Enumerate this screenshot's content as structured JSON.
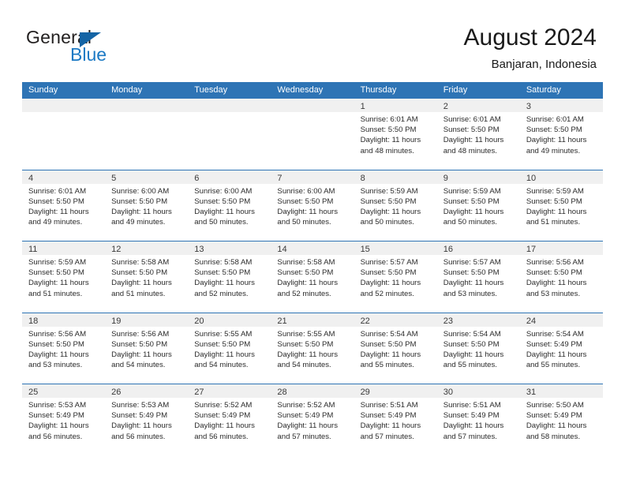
{
  "brand": {
    "name_primary": "General",
    "name_secondary": "Blue",
    "triangle_icon": "triangle-icon",
    "accent_color": "#1b79c4"
  },
  "header": {
    "title": "August 2024",
    "location": "Banjaran, Indonesia"
  },
  "calendar": {
    "header_bg": "#2e74b5",
    "daynum_bg": "#f0f0f0",
    "weekdays": [
      "Sunday",
      "Monday",
      "Tuesday",
      "Wednesday",
      "Thursday",
      "Friday",
      "Saturday"
    ],
    "weeks": [
      [
        {
          "day": "",
          "empty": true
        },
        {
          "day": "",
          "empty": true
        },
        {
          "day": "",
          "empty": true
        },
        {
          "day": "",
          "empty": true
        },
        {
          "day": "1",
          "sunrise": "Sunrise: 6:01 AM",
          "sunset": "Sunset: 5:50 PM",
          "daylight_1": "Daylight: 11 hours",
          "daylight_2": "and 48 minutes."
        },
        {
          "day": "2",
          "sunrise": "Sunrise: 6:01 AM",
          "sunset": "Sunset: 5:50 PM",
          "daylight_1": "Daylight: 11 hours",
          "daylight_2": "and 48 minutes."
        },
        {
          "day": "3",
          "sunrise": "Sunrise: 6:01 AM",
          "sunset": "Sunset: 5:50 PM",
          "daylight_1": "Daylight: 11 hours",
          "daylight_2": "and 49 minutes."
        }
      ],
      [
        {
          "day": "4",
          "sunrise": "Sunrise: 6:01 AM",
          "sunset": "Sunset: 5:50 PM",
          "daylight_1": "Daylight: 11 hours",
          "daylight_2": "and 49 minutes."
        },
        {
          "day": "5",
          "sunrise": "Sunrise: 6:00 AM",
          "sunset": "Sunset: 5:50 PM",
          "daylight_1": "Daylight: 11 hours",
          "daylight_2": "and 49 minutes."
        },
        {
          "day": "6",
          "sunrise": "Sunrise: 6:00 AM",
          "sunset": "Sunset: 5:50 PM",
          "daylight_1": "Daylight: 11 hours",
          "daylight_2": "and 50 minutes."
        },
        {
          "day": "7",
          "sunrise": "Sunrise: 6:00 AM",
          "sunset": "Sunset: 5:50 PM",
          "daylight_1": "Daylight: 11 hours",
          "daylight_2": "and 50 minutes."
        },
        {
          "day": "8",
          "sunrise": "Sunrise: 5:59 AM",
          "sunset": "Sunset: 5:50 PM",
          "daylight_1": "Daylight: 11 hours",
          "daylight_2": "and 50 minutes."
        },
        {
          "day": "9",
          "sunrise": "Sunrise: 5:59 AM",
          "sunset": "Sunset: 5:50 PM",
          "daylight_1": "Daylight: 11 hours",
          "daylight_2": "and 50 minutes."
        },
        {
          "day": "10",
          "sunrise": "Sunrise: 5:59 AM",
          "sunset": "Sunset: 5:50 PM",
          "daylight_1": "Daylight: 11 hours",
          "daylight_2": "and 51 minutes."
        }
      ],
      [
        {
          "day": "11",
          "sunrise": "Sunrise: 5:59 AM",
          "sunset": "Sunset: 5:50 PM",
          "daylight_1": "Daylight: 11 hours",
          "daylight_2": "and 51 minutes."
        },
        {
          "day": "12",
          "sunrise": "Sunrise: 5:58 AM",
          "sunset": "Sunset: 5:50 PM",
          "daylight_1": "Daylight: 11 hours",
          "daylight_2": "and 51 minutes."
        },
        {
          "day": "13",
          "sunrise": "Sunrise: 5:58 AM",
          "sunset": "Sunset: 5:50 PM",
          "daylight_1": "Daylight: 11 hours",
          "daylight_2": "and 52 minutes."
        },
        {
          "day": "14",
          "sunrise": "Sunrise: 5:58 AM",
          "sunset": "Sunset: 5:50 PM",
          "daylight_1": "Daylight: 11 hours",
          "daylight_2": "and 52 minutes."
        },
        {
          "day": "15",
          "sunrise": "Sunrise: 5:57 AM",
          "sunset": "Sunset: 5:50 PM",
          "daylight_1": "Daylight: 11 hours",
          "daylight_2": "and 52 minutes."
        },
        {
          "day": "16",
          "sunrise": "Sunrise: 5:57 AM",
          "sunset": "Sunset: 5:50 PM",
          "daylight_1": "Daylight: 11 hours",
          "daylight_2": "and 53 minutes."
        },
        {
          "day": "17",
          "sunrise": "Sunrise: 5:56 AM",
          "sunset": "Sunset: 5:50 PM",
          "daylight_1": "Daylight: 11 hours",
          "daylight_2": "and 53 minutes."
        }
      ],
      [
        {
          "day": "18",
          "sunrise": "Sunrise: 5:56 AM",
          "sunset": "Sunset: 5:50 PM",
          "daylight_1": "Daylight: 11 hours",
          "daylight_2": "and 53 minutes."
        },
        {
          "day": "19",
          "sunrise": "Sunrise: 5:56 AM",
          "sunset": "Sunset: 5:50 PM",
          "daylight_1": "Daylight: 11 hours",
          "daylight_2": "and 54 minutes."
        },
        {
          "day": "20",
          "sunrise": "Sunrise: 5:55 AM",
          "sunset": "Sunset: 5:50 PM",
          "daylight_1": "Daylight: 11 hours",
          "daylight_2": "and 54 minutes."
        },
        {
          "day": "21",
          "sunrise": "Sunrise: 5:55 AM",
          "sunset": "Sunset: 5:50 PM",
          "daylight_1": "Daylight: 11 hours",
          "daylight_2": "and 54 minutes."
        },
        {
          "day": "22",
          "sunrise": "Sunrise: 5:54 AM",
          "sunset": "Sunset: 5:50 PM",
          "daylight_1": "Daylight: 11 hours",
          "daylight_2": "and 55 minutes."
        },
        {
          "day": "23",
          "sunrise": "Sunrise: 5:54 AM",
          "sunset": "Sunset: 5:50 PM",
          "daylight_1": "Daylight: 11 hours",
          "daylight_2": "and 55 minutes."
        },
        {
          "day": "24",
          "sunrise": "Sunrise: 5:54 AM",
          "sunset": "Sunset: 5:49 PM",
          "daylight_1": "Daylight: 11 hours",
          "daylight_2": "and 55 minutes."
        }
      ],
      [
        {
          "day": "25",
          "sunrise": "Sunrise: 5:53 AM",
          "sunset": "Sunset: 5:49 PM",
          "daylight_1": "Daylight: 11 hours",
          "daylight_2": "and 56 minutes."
        },
        {
          "day": "26",
          "sunrise": "Sunrise: 5:53 AM",
          "sunset": "Sunset: 5:49 PM",
          "daylight_1": "Daylight: 11 hours",
          "daylight_2": "and 56 minutes."
        },
        {
          "day": "27",
          "sunrise": "Sunrise: 5:52 AM",
          "sunset": "Sunset: 5:49 PM",
          "daylight_1": "Daylight: 11 hours",
          "daylight_2": "and 56 minutes."
        },
        {
          "day": "28",
          "sunrise": "Sunrise: 5:52 AM",
          "sunset": "Sunset: 5:49 PM",
          "daylight_1": "Daylight: 11 hours",
          "daylight_2": "and 57 minutes."
        },
        {
          "day": "29",
          "sunrise": "Sunrise: 5:51 AM",
          "sunset": "Sunset: 5:49 PM",
          "daylight_1": "Daylight: 11 hours",
          "daylight_2": "and 57 minutes."
        },
        {
          "day": "30",
          "sunrise": "Sunrise: 5:51 AM",
          "sunset": "Sunset: 5:49 PM",
          "daylight_1": "Daylight: 11 hours",
          "daylight_2": "and 57 minutes."
        },
        {
          "day": "31",
          "sunrise": "Sunrise: 5:50 AM",
          "sunset": "Sunset: 5:49 PM",
          "daylight_1": "Daylight: 11 hours",
          "daylight_2": "and 58 minutes."
        }
      ]
    ]
  }
}
